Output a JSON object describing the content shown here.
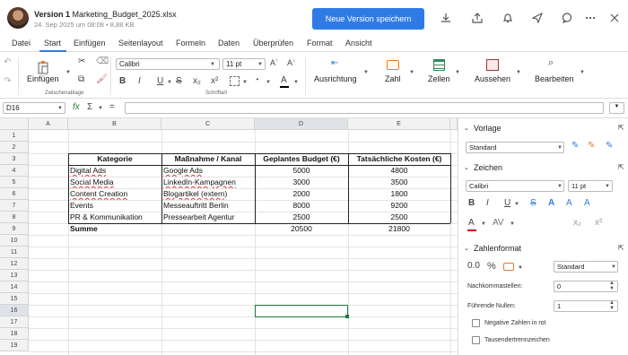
{
  "title_bar": {
    "version_label": "Version 1",
    "file_name": "Marketing_Budget_2025.xlsx",
    "meta": "24. Sep 2025 um 08:08 • 8,88 KB",
    "primary_button": "Neue Version speichern"
  },
  "menu": {
    "tabs": [
      "Datei",
      "Start",
      "Einfügen",
      "Seitenlayout",
      "Formeln",
      "Daten",
      "Überprüfen",
      "Format",
      "Ansicht"
    ],
    "active_tab": "Start"
  },
  "ribbon": {
    "paste_label": "Einfügen",
    "clipboard_group": "Zwischenablage",
    "font_name": "Calibri",
    "font_size": "11 pt",
    "font_group": "Schriftart",
    "bold": "B",
    "italic": "I",
    "underline": "U",
    "strike": "S",
    "subscript": "x₂",
    "superscript": "x²",
    "font_color_glyph": "A",
    "alignment_label": "Ausrichtung",
    "number_label": "Zahl",
    "cells_label": "Zellen",
    "view_label": "Aussehen",
    "edit_label": "Bearbeiten"
  },
  "formula_bar": {
    "cell_ref": "D16",
    "fx": "fx",
    "sum": "Σ",
    "equals": "=",
    "formula": ""
  },
  "sheet": {
    "columns": [
      "A",
      "B",
      "C",
      "D",
      "E"
    ],
    "selected_column": "D",
    "rows": [
      "1",
      "2",
      "3",
      "4",
      "5",
      "6",
      "7",
      "8",
      "9",
      "10",
      "11",
      "12",
      "13",
      "14",
      "15",
      "16",
      "17",
      "18",
      "19"
    ],
    "selected_row": "16",
    "headers": [
      "Kategorie",
      "Maßnahme / Kanal",
      "Geplantes Budget (€)",
      "Tatsächliche Kosten (€)"
    ],
    "data": [
      [
        "Digital Ads",
        "Google Ads",
        "5000",
        "4800"
      ],
      [
        "Social Media",
        "LinkedIn-Kampagnen",
        "3000",
        "3500"
      ],
      [
        "Content Creation",
        "Blogartikel (extern)",
        "2000",
        "1800"
      ],
      [
        "Events",
        "Messeauftritt Berlin",
        "8000",
        "9200"
      ],
      [
        "PR & Kommunikation",
        "Pressearbeit Agentur",
        "2500",
        "2500"
      ]
    ],
    "total": [
      "Summe",
      "",
      "20500",
      "21800"
    ]
  },
  "panel": {
    "style_section": "Vorlage",
    "style_value": "Standard",
    "font_section": "Zeichen",
    "font_name": "Calibri",
    "font_size": "11 pt",
    "number_section": "Zahlenformat",
    "number_format": "Standard",
    "decimals_label": "Nachkommastellen:",
    "decimals_value": "0",
    "leading_zeros_label": "Führende Nullen:",
    "leading_zeros_value": "1",
    "negative_red_label": "Negative Zahlen in rot",
    "thousands_sep_label": "Tausendertrennzeichen"
  },
  "colors": {
    "accent": "#2f7be5",
    "selection": "#1f7a3a",
    "header_bg": "#f2f2f2"
  }
}
